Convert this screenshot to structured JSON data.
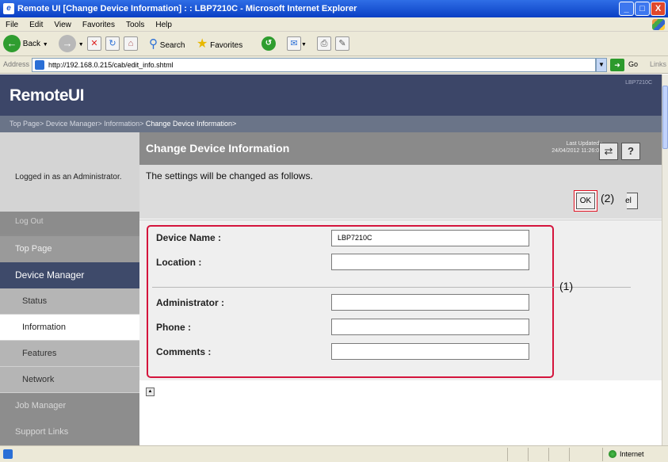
{
  "window": {
    "title": "Remote UI [Change Device Information] : : LBP7210C - Microsoft Internet Explorer",
    "controls": [
      "_",
      "□",
      "X"
    ]
  },
  "menu": [
    "File",
    "Edit",
    "View",
    "Favorites",
    "Tools",
    "Help"
  ],
  "toolbar": {
    "back_label": "Back",
    "search_label": "Search",
    "favorites_label": "Favorites"
  },
  "address": {
    "label": "Address",
    "url": "http://192.168.0.215/cab/edit_info.shtml",
    "go_label": "Go",
    "links_label": "Links"
  },
  "header": {
    "logo": "RemoteUI",
    "model": "LBP7210C"
  },
  "breadcrumb": {
    "items": [
      "Top Page>",
      "Device Manager>",
      "Information>"
    ],
    "current": "Change Device Information>"
  },
  "sidebar": {
    "login_text": "Logged in as an Administrator.",
    "logout": "Log Out",
    "top_page": "Top Page",
    "device_manager": "Device Manager",
    "sub_items": [
      "Status",
      "Information",
      "Features",
      "Network"
    ],
    "active_item": "Information",
    "job_manager": "Job Manager",
    "support_links": "Support Links"
  },
  "content": {
    "title": "Change Device Information",
    "last_updated_label": "Last Updated :",
    "last_updated_value": "24/04/2012 11:26:01",
    "refresh_icon": "refresh-icon",
    "help_label": "?",
    "message": "The settings will be changed as follows.",
    "ok_label": "OK",
    "cancel_label": "el",
    "callout_ok": "(2)",
    "callout_form": "(1)",
    "fields": [
      {
        "label": "Device Name :",
        "value": "LBP7210C"
      },
      {
        "label": "Location :",
        "value": ""
      },
      {
        "label": "Administrator :",
        "value": ""
      },
      {
        "label": "Phone :",
        "value": ""
      },
      {
        "label": "Comments :",
        "value": ""
      }
    ]
  },
  "status": {
    "zone": "Internet"
  },
  "colors": {
    "header_bg": "#3c4668",
    "highlight_red": "#d4143c",
    "nav_active": "#3e4a6a"
  }
}
